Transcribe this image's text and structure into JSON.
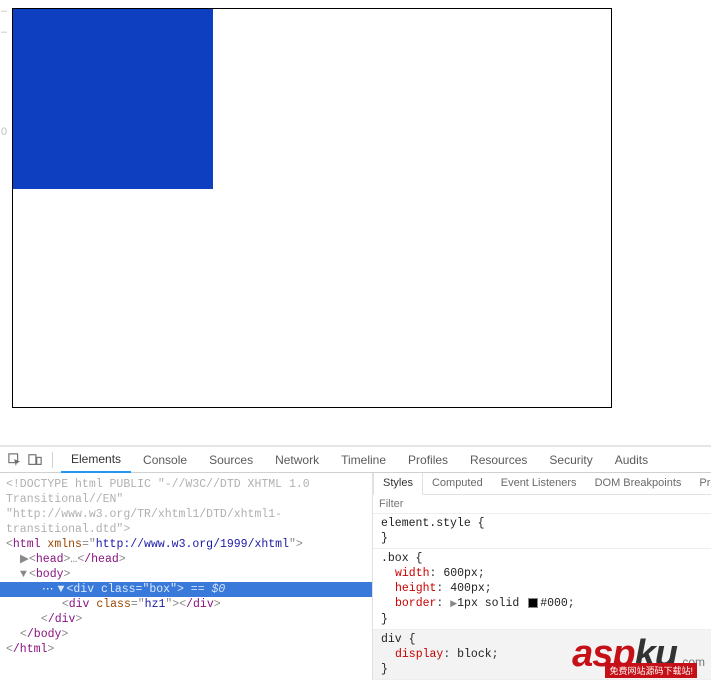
{
  "tabs": {
    "items": [
      "Elements",
      "Console",
      "Sources",
      "Network",
      "Timeline",
      "Profiles",
      "Resources",
      "Security",
      "Audits"
    ],
    "active": "Elements"
  },
  "dom": {
    "doctype": "<!DOCTYPE html PUBLIC \"-//W3C//DTD XHTML 1.0 Transitional//EN\" \"http://www.w3.org/TR/xhtml1/DTD/xhtml1-transitional.dtd\">",
    "html_open": {
      "tag": "html",
      "attr_name": "xmlns",
      "attr_value": "http://www.w3.org/1999/xhtml"
    },
    "head": {
      "open": "head",
      "ellipsis": "…",
      "close": "/head"
    },
    "body_open": "body",
    "selected": {
      "tag": "div",
      "attr_name": "class",
      "attr_value": "box",
      "suffix": " == $0"
    },
    "child": {
      "tag": "div",
      "attr_name": "class",
      "attr_value": "hz1"
    },
    "div_close": "/div",
    "body_close": "/body",
    "html_close": "/html"
  },
  "styles_tabs": [
    "Styles",
    "Computed",
    "Event Listeners",
    "DOM Breakpoints",
    "Proper"
  ],
  "styles_active": "Styles",
  "filter_placeholder": "Filter",
  "rules": {
    "element_style": {
      "selector": "element.style",
      "props": []
    },
    "box": {
      "selector": ".box",
      "props": [
        {
          "name": "width",
          "value": "600px"
        },
        {
          "name": "height",
          "value": "400px"
        },
        {
          "name": "border",
          "value_prefix": "1px solid",
          "swatch": "#000",
          "value_suffix": "#000"
        }
      ]
    },
    "div": {
      "selector": "div",
      "props": [
        {
          "name": "display",
          "value": "block"
        }
      ]
    }
  },
  "watermark": {
    "a": "asp",
    "b": "ku",
    "c": ".com",
    "sub": "免费网站源码下载站!"
  }
}
